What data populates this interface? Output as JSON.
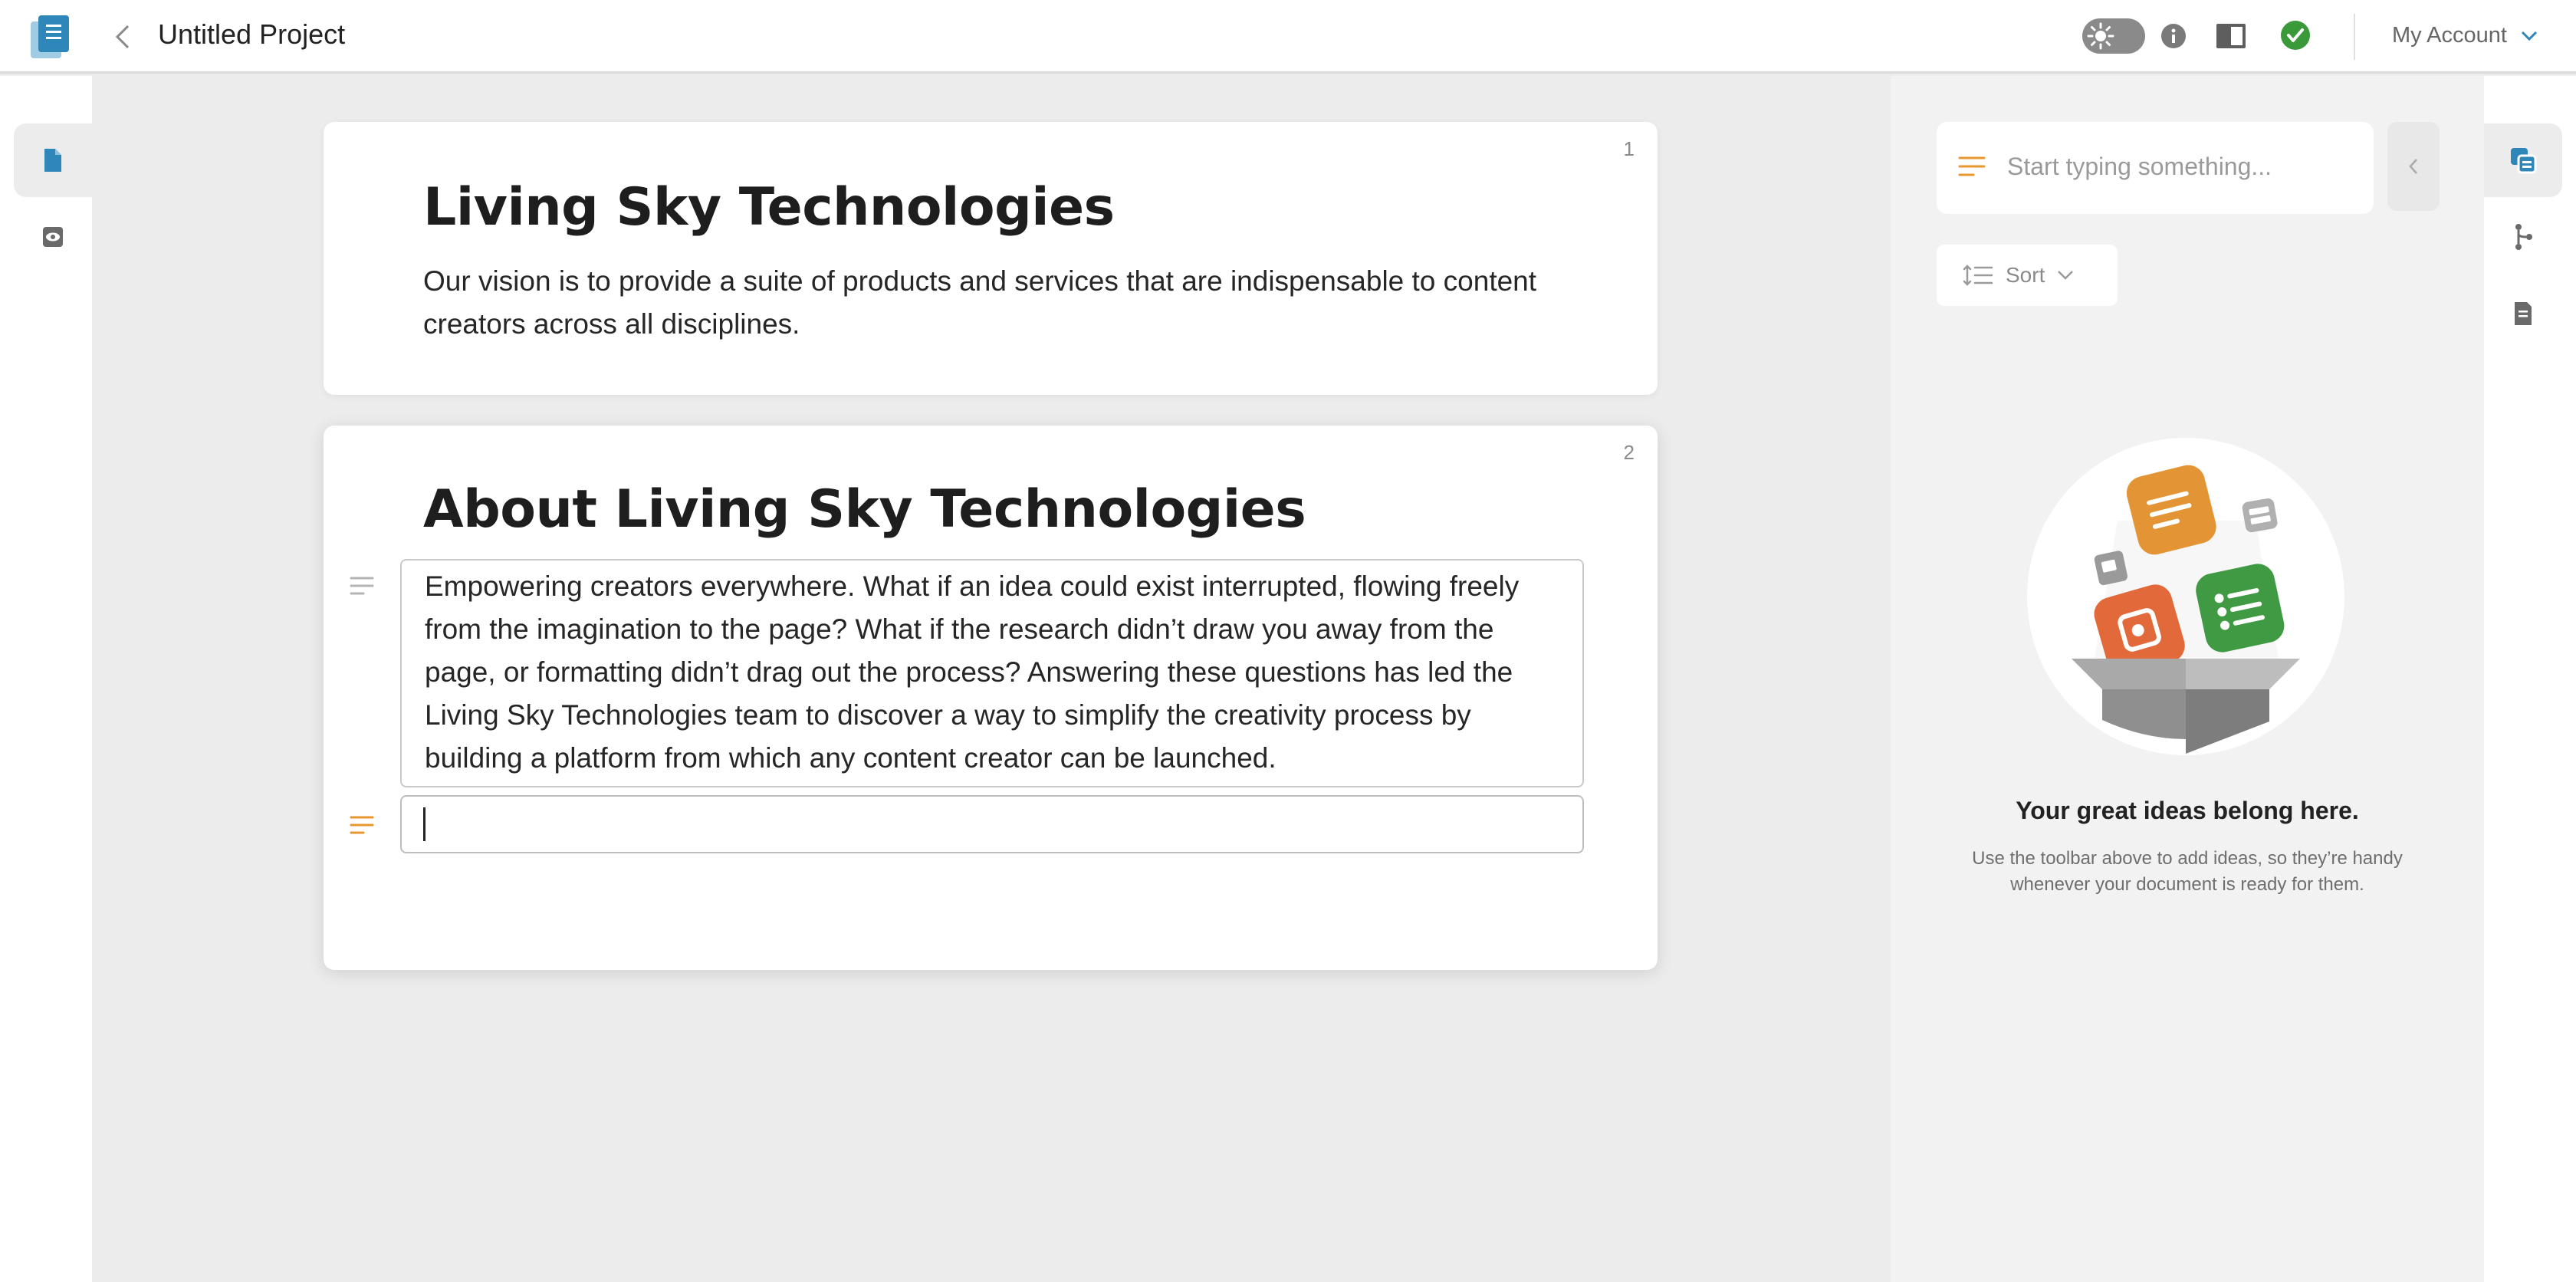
{
  "header": {
    "project_title": "Untitled Project",
    "account_label": "My Account"
  },
  "document": {
    "pages": [
      {
        "number": "1",
        "title": "Living Sky Technologies",
        "paragraph": "Our vision is to provide a suite of products and services that are indispensable to content creators across all disciplines."
      },
      {
        "number": "2",
        "title": "About Living Sky Technologies",
        "paragraph": "Empowering creators everywhere. What if an idea could exist interrupted, flowing freely from the imagination to the page? What if the research didn’t draw you away from the page, or formatting didn’t drag out the process? Answering these questions has led the Living Sky Technologies team to discover a way to simplify the creativity process by building a platform from which any content creator can be launched.",
        "new_paragraph_value": ""
      }
    ]
  },
  "ideas_panel": {
    "input_placeholder": "Start typing something...",
    "sort_label": "Sort",
    "empty_title": "Your great ideas belong here.",
    "empty_description": "Use the toolbar above to add ideas, so they’re handy whenever your document is ready for them."
  },
  "colors": {
    "accent_blue": "#2f86b8",
    "accent_orange": "#e8962e",
    "status_green": "#3a9a3a",
    "idea_orange": "#e39535",
    "idea_red": "#e2693a",
    "idea_green": "#3f9a43"
  },
  "icons": {
    "left_rail": [
      "document-icon",
      "preview-eye-icon"
    ],
    "right_rail": [
      "ideas-icon",
      "outline-tree-icon",
      "notes-icon"
    ]
  }
}
